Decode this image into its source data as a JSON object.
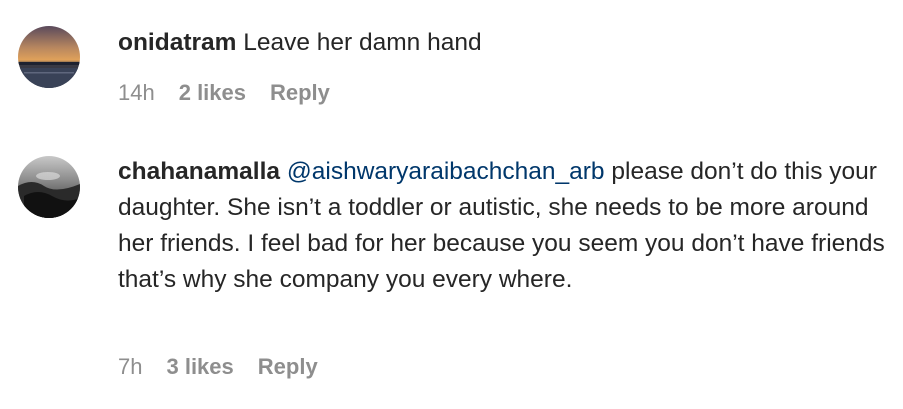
{
  "comments": [
    {
      "username": "onidatram",
      "mention": "",
      "text": " Leave her damn hand",
      "time": "14h",
      "likes": "2 likes",
      "reply": "Reply"
    },
    {
      "username": "chahanamalla",
      "mention": "@aishwaryaraibachchan_arb",
      "text": " please don’t do this your daughter. She isn’t a toddler or autistic, she needs to be more around her friends. I feel bad for her because you seem you don’t have friends that’s why she company you every where.",
      "time": "7h",
      "likes": "3 likes",
      "reply": "Reply"
    }
  ],
  "colors": {
    "username": "#262626",
    "mention": "#00376b",
    "meta": "#8e8e8e"
  },
  "icons": [
    "avatar-sunset-icon",
    "avatar-mono-icon"
  ]
}
